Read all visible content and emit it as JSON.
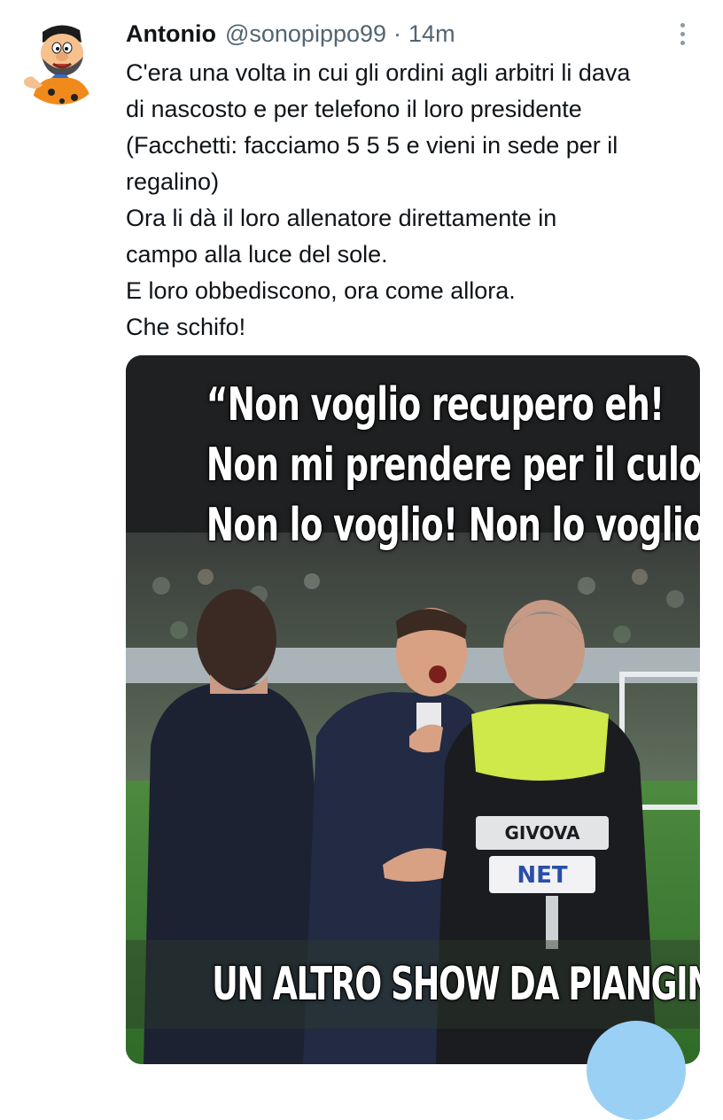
{
  "tweet": {
    "author_name": "Antonio",
    "handle": "@sonopippo99",
    "separator": "·",
    "time": "14m",
    "text_lines": [
      "C'era una volta in cui gli ordini agli arbitri li dava",
      "di nascosto e per telefono il loro presidente",
      "(Facchetti: facciamo 5 5 5 e vieni in sede per il",
      "regalino)",
      "Ora li dà il loro allenatore direttamente in",
      "campo alla luce del sole.",
      "E loro obbediscono, ora come allora.",
      "Che schifo!"
    ]
  },
  "media": {
    "caption_lines": [
      "“Non voglio recupero eh!",
      "Non mi prendere per il culo!",
      "Non lo voglio! Non lo voglio!”"
    ],
    "bottom_caption": "UN ALTRO SHOW DA PIANGINA",
    "jersey_brand": "GIVOVA",
    "jersey_sponsor": "NET"
  },
  "icons": {
    "more": "more-vertical-icon",
    "compose": "compose-fab-icon"
  }
}
